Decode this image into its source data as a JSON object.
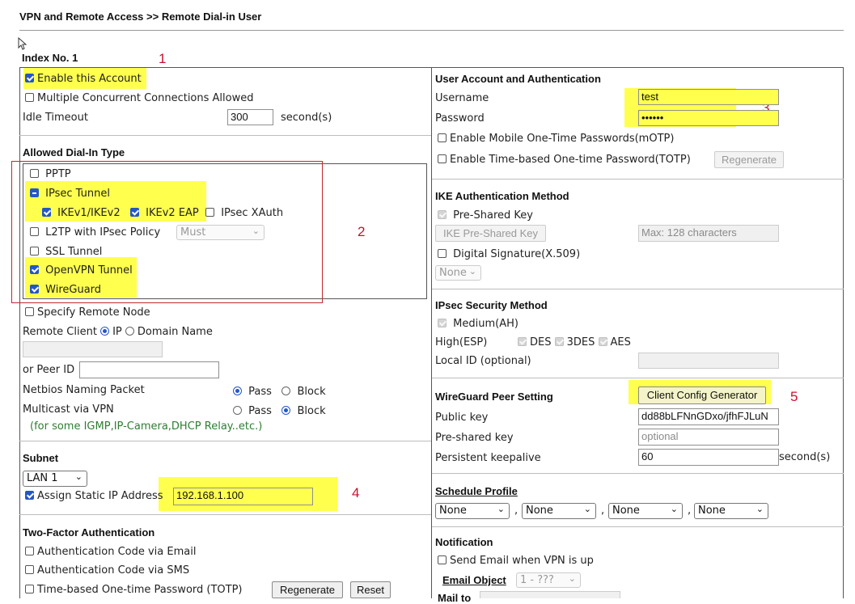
{
  "breadcrumb": "VPN and Remote Access >> Remote Dial-in User",
  "index_label": "Index No. 1",
  "annotations": [
    "1",
    "2",
    "3",
    "4",
    "5"
  ],
  "left": {
    "enable_account": "Enable this Account",
    "multiple_connections": "Multiple Concurrent Connections Allowed",
    "idle_timeout_label": "Idle Timeout",
    "idle_timeout_value": "300",
    "idle_timeout_unit": "second(s)",
    "allowed_title": "Allowed Dial-In Type",
    "pptp": "PPTP",
    "ipsec_tunnel": "IPsec Tunnel",
    "ikev1": "IKEv1/IKEv2",
    "ikev2_eap": "IKEv2 EAP",
    "ipsec_xauth": "IPsec XAuth",
    "l2tp": "L2TP with IPsec Policy",
    "l2tp_policy": "Must",
    "ssl_tunnel": "SSL Tunnel",
    "openvpn": "OpenVPN Tunnel",
    "wireguard": "WireGuard",
    "specify_remote": "Specify Remote Node",
    "remote_client": "Remote Client",
    "ip": "IP",
    "domain_name": "Domain Name",
    "peer_id": "or Peer ID",
    "netbios": "Netbios Naming Packet",
    "multicast": "Multicast via VPN",
    "pass": "Pass",
    "block": "Block",
    "multicast_note": "(for some IGMP,IP-Camera,DHCP Relay..etc.)",
    "subnet_title": "Subnet",
    "subnet_value": "LAN 1",
    "assign_static": "Assign Static IP Address",
    "static_ip": "192.168.1.100",
    "twofa_title": "Two-Factor Authentication",
    "auth_email": "Authentication Code via Email",
    "auth_sms": "Authentication Code via SMS",
    "totp": "Time-based One-time Password (TOTP)",
    "regenerate": "Regenerate",
    "reset": "Reset"
  },
  "right": {
    "ua_title": "User Account and Authentication",
    "username_label": "Username",
    "username_value": "test",
    "password_label": "Password",
    "password_value": "••••••",
    "motp": "Enable Mobile One-Time Passwords(mOTP)",
    "totp": "Enable Time-based One-time Password(TOTP)",
    "regenerate": "Regenerate",
    "ike_title": "IKE Authentication Method",
    "psk": "Pre-Shared Key",
    "ike_psk_button": "IKE Pre-Shared Key",
    "psk_placeholder": "Max: 128 characters",
    "digital_sig": "Digital Signature(X.509)",
    "digital_sig_select": "None",
    "ipsec_title": "IPsec Security Method",
    "medium": "Medium(AH)",
    "high": "High(ESP)",
    "des": "DES",
    "3des": "3DES",
    "aes": "AES",
    "local_id": "Local ID (optional)",
    "wg_title": "WireGuard Peer Setting",
    "client_config": "Client Config Generator",
    "public_key_label": "Public key",
    "public_key_value": "dd88bLFNnGDxo/jfhFJLuN",
    "preshared_label": "Pre-shared key",
    "preshared_placeholder": "optional",
    "keepalive_label": "Persistent keepalive",
    "keepalive_value": "60",
    "keepalive_unit": "second(s)",
    "schedule_title": "Schedule Profile",
    "schedule_values": [
      "None",
      "None",
      "None",
      "None"
    ],
    "comma": ",",
    "notification_title": "Notification",
    "send_email": "Send Email when VPN is up",
    "email_object_label": "Email Object",
    "email_object_value": "1 - ???",
    "mail_to_label": "Mail to"
  },
  "colors": {
    "highlight": "#ffff4d",
    "annotation": "#c8102e",
    "accent": "#2457c5"
  }
}
